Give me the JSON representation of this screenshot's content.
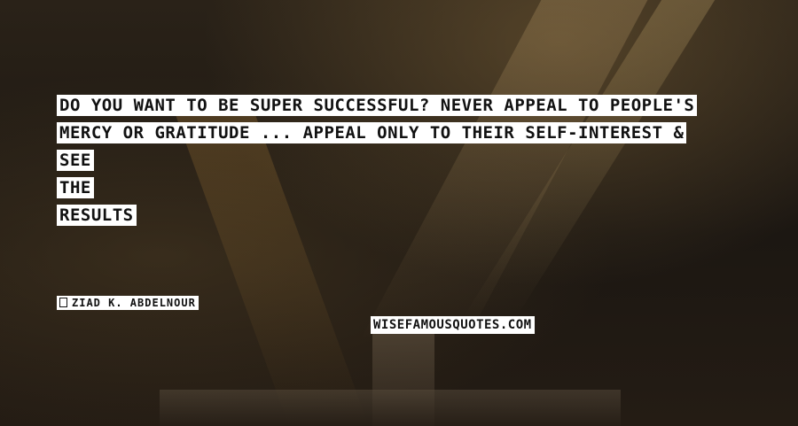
{
  "quote": {
    "lines": [
      "DO YOU WANT TO BE SUPER SUCCESSFUL? NEVER APPEAL TO PEOPLE'S",
      "MERCY OR GRATITUDE ... APPEAL ONLY TO THEIR SELF-INTEREST &",
      "SEE",
      "THE",
      "RESULTS"
    ]
  },
  "author": {
    "name": "ZIAD K. ABDELNOUR"
  },
  "watermark": {
    "text": "WISEFAMOUSQUOTES.COM"
  },
  "colors": {
    "highlight": "#ffffff",
    "text": "#111111"
  }
}
